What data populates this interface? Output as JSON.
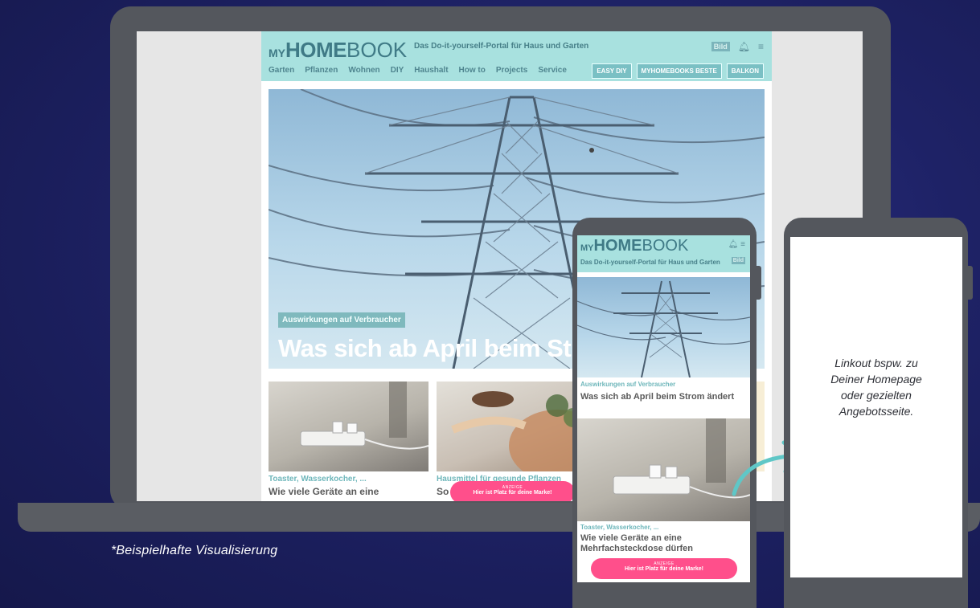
{
  "caption": "*Beispielhafte Visualisierung",
  "desktop": {
    "logo": {
      "my": "MY",
      "home": "HOME",
      "book": "BOOK"
    },
    "tagline": "Das Do-it-yourself-Portal für Haus und Garten",
    "bild_badge": "Bild",
    "nav": [
      "Garten",
      "Pflanzen",
      "Wohnen",
      "DIY",
      "Haushalt",
      "How to",
      "Projects",
      "Service"
    ],
    "chips": [
      "EASY DIY",
      "MYHOMEBOOKS BESTE",
      "BALKON"
    ],
    "hero": {
      "badge": "Auswirkungen auf Verbraucher",
      "title": "Was sich ab April beim Strom än"
    },
    "cards": [
      {
        "kicker": "Toaster, Wasserkocher, ...",
        "title": "Wie viele Geräte an eine"
      },
      {
        "kicker": "Hausmittel für gesunde Pflanzen",
        "title": "So"
      }
    ],
    "ad": {
      "small": "ANZEIGE",
      "big": "Hier ist Platz für deine Marke!"
    }
  },
  "mobile": {
    "logo": {
      "my": "MY",
      "home": "HOME",
      "book": "BOOK"
    },
    "tagline": "Das Do-it-yourself-Portal für Haus und Garten",
    "bild_badge": "Bild",
    "article1": {
      "kicker": "Auswirkungen auf Verbraucher",
      "title": "Was sich ab April beim Strom ändert"
    },
    "article2": {
      "kicker": "Toaster, Wasserkocher, ...",
      "title": "Wie viele Geräte an eine Mehrfachsteckdose dürfen"
    },
    "ad": {
      "small": "ANZEIGE",
      "big": "Hier ist Platz für deine Marke!"
    }
  },
  "landing": {
    "text_lines": [
      "Linkout bspw. zu",
      "Deiner Homepage",
      "oder gezielten",
      "Angebotsseite."
    ]
  },
  "colors": {
    "background": "#1e2266",
    "device_frame": "#54575d",
    "header_mint": "#a8e1df",
    "accent_teal": "#6fb7bb",
    "ad_pink": "#ff4f8b",
    "arrow": "#5fc7c7"
  }
}
